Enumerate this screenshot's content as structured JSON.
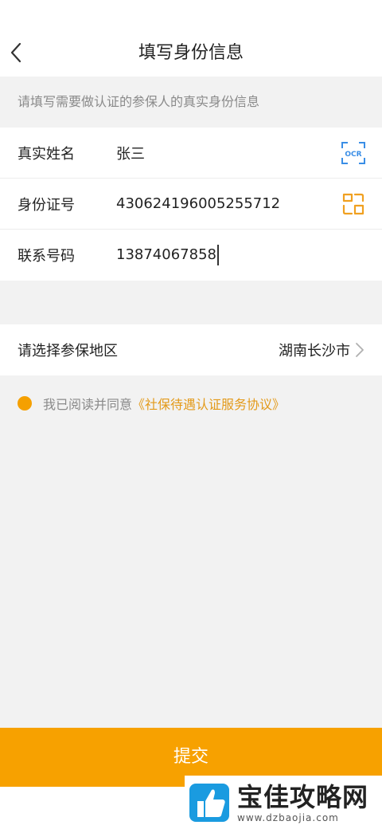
{
  "header": {
    "title": "填写身份信息"
  },
  "hint": "请填写需要做认证的参保人的真实身份信息",
  "form": {
    "rows": [
      {
        "label": "真实姓名",
        "value": "张三",
        "icon": "ocr-scan-icon"
      },
      {
        "label": "身份证号",
        "value": "430624196005255712",
        "icon": "scan-icon"
      },
      {
        "label": "联系号码",
        "value": "13874067858"
      }
    ]
  },
  "region": {
    "label": "请选择参保地区",
    "value": "湖南长沙市"
  },
  "agreement": {
    "text": "我已阅读并同意",
    "link": "《社保待遇认证服务协议》"
  },
  "submit": {
    "label": "提交"
  },
  "watermark": {
    "text": "宝佳攻略网",
    "url": "www.dzbaojia.com"
  },
  "colors": {
    "accent": "#f7a100",
    "ocr": "#3a8ee6",
    "link": "#e39a1a"
  }
}
